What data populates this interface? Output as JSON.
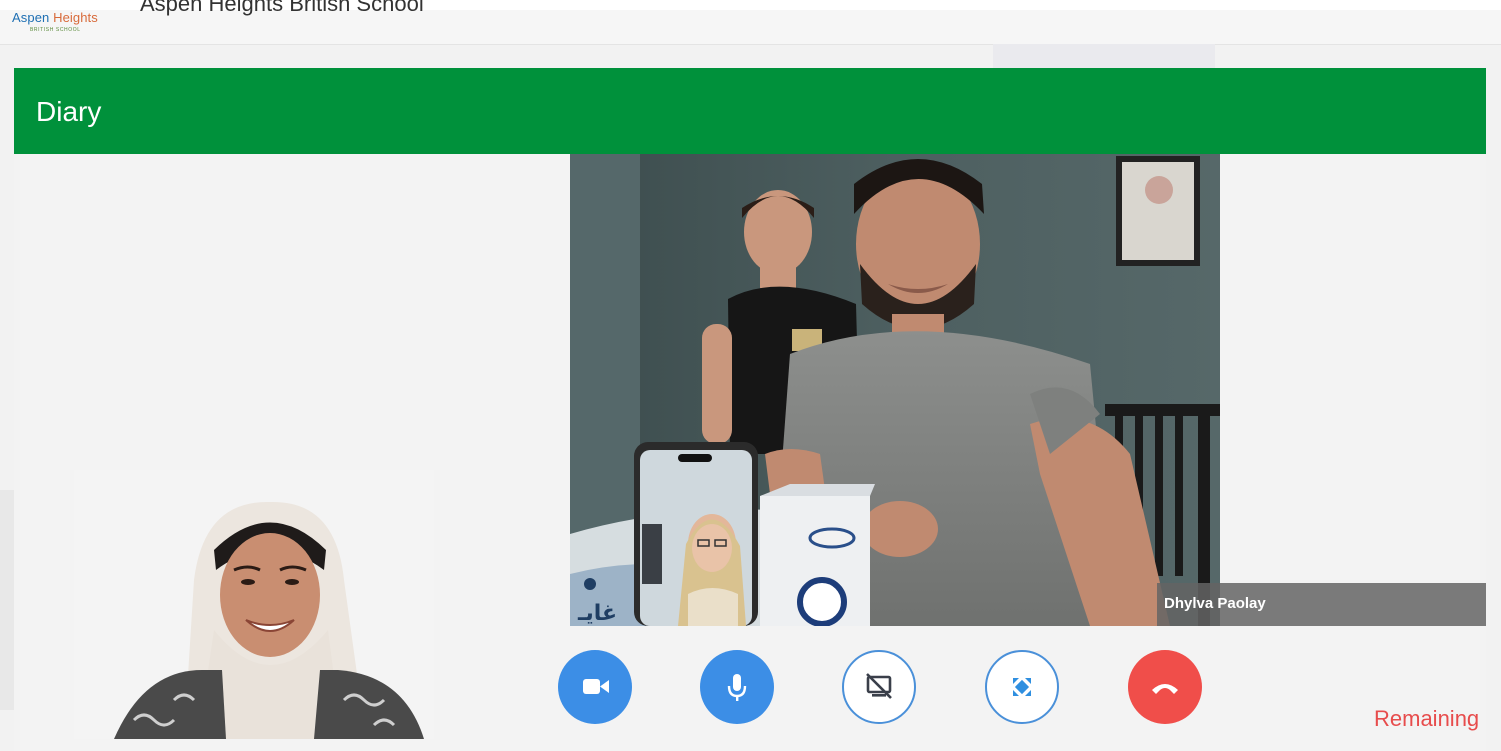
{
  "header": {
    "brand_name_part1": "Aspen",
    "brand_name_part2": "Heights",
    "brand_subtitle": "BRITISH SCHOOL",
    "school_name": "Aspen Heights British School"
  },
  "diary": {
    "title": "Diary"
  },
  "call": {
    "remote_participant_name": "Dhylva Paolay",
    "remote_participant_extra": "",
    "remaining_label": "Remaining",
    "controls": [
      {
        "name": "camera",
        "icon": "video-camera-icon"
      },
      {
        "name": "microphone",
        "icon": "microphone-icon"
      },
      {
        "name": "screen-share",
        "icon": "screen-share-off-icon"
      },
      {
        "name": "fullscreen",
        "icon": "fullscreen-icon"
      },
      {
        "name": "end-call",
        "icon": "phone-hangup-icon"
      }
    ]
  },
  "colors": {
    "diary_bar": "#00913b",
    "control_blue": "#3c8ee6",
    "control_outline": "#4a90d9",
    "end_call_red": "#f04e4a",
    "remaining_text": "#e74c4c"
  }
}
